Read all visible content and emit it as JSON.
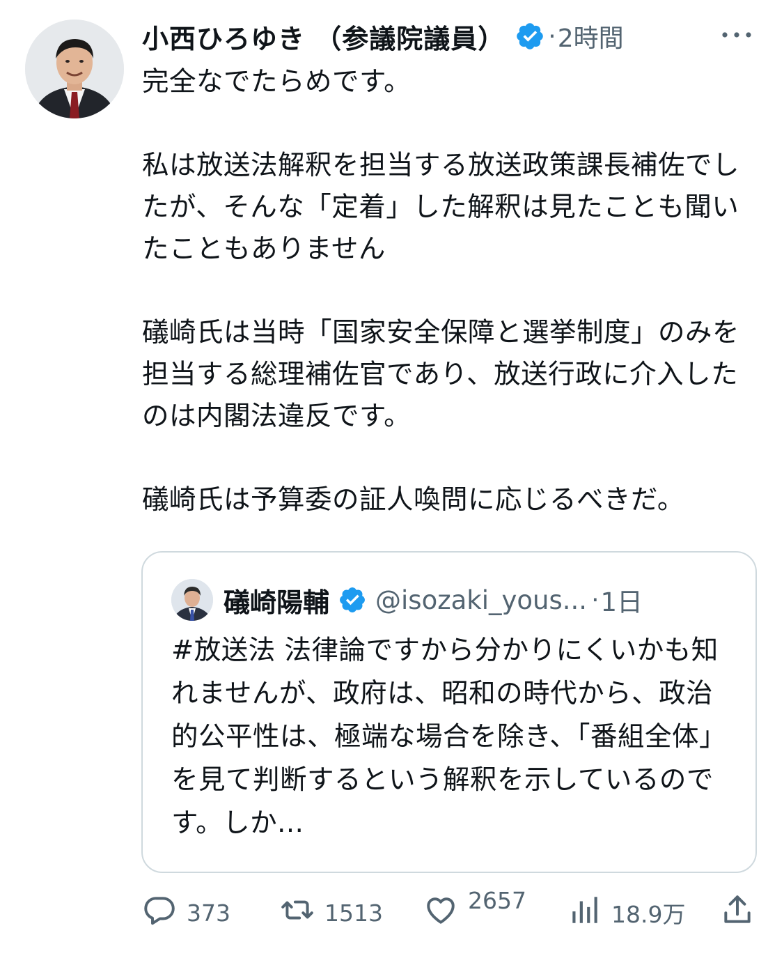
{
  "tweet": {
    "author_name": "小西ひろゆき （参議院議員）",
    "separator": "·",
    "time_ago": "2時間",
    "body": "完全なでたらめです。\n\n私は放送法解釈を担当する放送政策課長補佐でしたが、そんな「定着」した解釈は見たことも聞いたこともありません\n\n礒崎氏は当時「国家安全保障と選挙制度」のみを担当する総理補佐官であり、放送行政に介入したのは内閣法違反です。\n\n礒崎氏は予算委の証人喚問に応じるべきだ。"
  },
  "quoted_tweet": {
    "author_name": "礒崎陽輔",
    "handle": "@isozaki_yous...",
    "separator": "·",
    "time_ago": "1日",
    "body": "#放送法 法律論ですから分かりにくいかも知れませんが、政府は、昭和の時代から、政治的公平性は、極端な場合を除き、「番組全体」を見て判断するという解釈を示しているのです。しか..."
  },
  "actions": {
    "replies": "373",
    "reposts": "1513",
    "likes": "2657",
    "views": "18.9万"
  },
  "icons": {
    "verified": "verified-badge-icon",
    "more": "more-horizontal-icon",
    "reply": "reply-bubble-icon",
    "repost": "repost-arrows-icon",
    "like": "heart-icon",
    "views": "bar-chart-icon",
    "share": "share-upload-icon"
  },
  "colors": {
    "text": "#0f1419",
    "muted": "#536471",
    "verified_blue": "#1d9bf0",
    "border": "#cfd9de"
  }
}
